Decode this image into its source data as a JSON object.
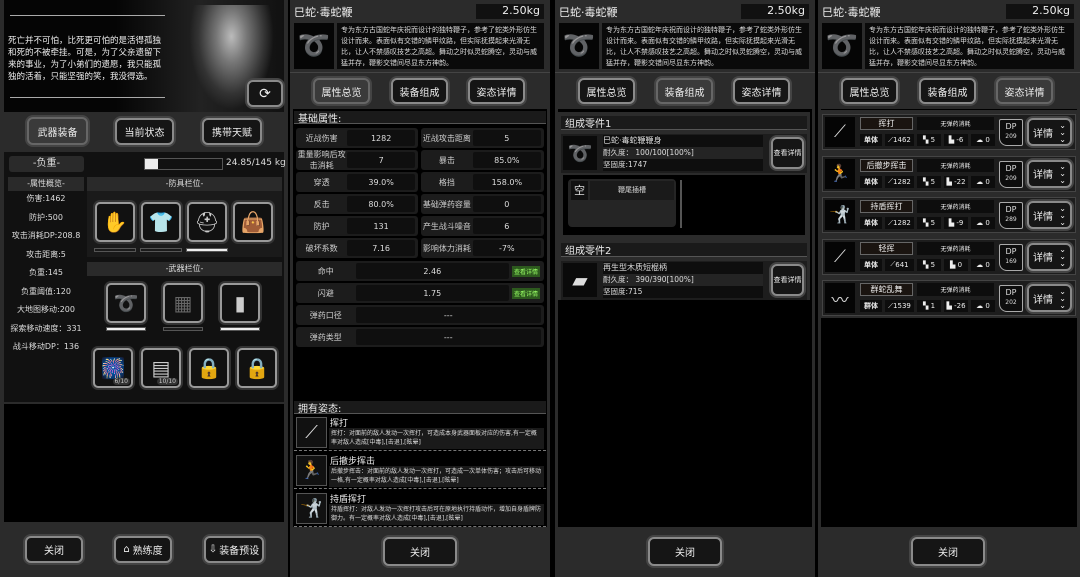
{
  "panel1": {
    "quote": "死亡并不可怕，比死更可怕的是活得孤独和死的不被牵挂。可是，为了父亲遗留下来的事业，为了小弟们的遗愿，我只能孤独的活着，只能坚强的笑，我没得选。",
    "tabs": [
      "武器装备",
      "当前状态",
      "携带天赋"
    ],
    "load": {
      "label": "-负重-",
      "value": "24.85/145 kg",
      "fraction": 0.17
    },
    "attr_title": "-属性概览-",
    "attrs": [
      "伤害:1462",
      "防护:500",
      "攻击消耗DP:208.8",
      "攻击距离:5",
      "负重:145",
      "负重阈值:120",
      "大地图移动:200",
      "探索移动速度：331",
      "战斗移动DP：136"
    ],
    "armor_title": "-防具栏位-",
    "weapon_title": "-武器栏位-",
    "consumables": [
      "6/10",
      "10/10"
    ],
    "buttons": {
      "close": "关闭",
      "proficiency": "熟练度",
      "preset": "装备预设"
    }
  },
  "weapon": {
    "name": "巳蛇·毒蛇鞭",
    "weight": "2.50kg",
    "desc": "专为东方古国蛇年庆祝而设计的独特鞭子，参考了蛇类外形仿生设计而来。表面似有交错的鳞甲纹路，但实际抚摸起来光滑无比，让人不禁感叹技艺之高超。舞动之时似灵蛇腾空，灵动与威猛并存，鞭影交错间尽显东方神韵。",
    "tabs": [
      "属性总览",
      "装备组成",
      "姿态详情"
    ]
  },
  "stats": {
    "title": "基础属性:",
    "pairs": [
      [
        "近战伤害",
        "1282",
        "近战攻击距离",
        "5"
      ],
      [
        "重量影响后攻击消耗",
        "7",
        "暴击",
        "85.0%"
      ],
      [
        "穿透",
        "39.0%",
        "格挡",
        "158.0%"
      ],
      [
        "反击",
        "80.0%",
        "基础弹药容量",
        "0"
      ],
      [
        "防护",
        "131",
        "产生战斗噪音",
        "6"
      ],
      [
        "破坏系数",
        "7.16",
        "影响体力消耗",
        "-7%"
      ]
    ],
    "wide": [
      {
        "label": "命中",
        "value": "2.46",
        "detail": "查看详情"
      },
      {
        "label": "闪避",
        "value": "1.75",
        "detail": "查看详情"
      },
      {
        "label": "弹药口径",
        "value": "---"
      },
      {
        "label": "弹药类型",
        "value": "---"
      }
    ]
  },
  "stances": {
    "title": "拥有姿态:",
    "items": [
      {
        "name": "挥打",
        "desc": "挥打：对面前的敌人发动一次挥打，可造成本身武器面板对应的伤害,有一定概率对敌人造成[中毒],[击退],[眩晕]"
      },
      {
        "name": "后撤步挥击",
        "desc": "后撤步挥击：对面前的敌人发动一次挥打，可造成一次单体伤害；攻击后可移动一格,有一定概率对敌人造成[中毒],[击退],[眩晕]"
      },
      {
        "name": "持盾挥打",
        "desc": "持盾挥打：对敌人发动一次挥打攻击后可在原地执行持盾动作，增加自身盾牌防御力。有一定概率对敌人造成[中毒],[击退],[眩晕]"
      }
    ]
  },
  "parts": [
    {
      "title": "组成零件1",
      "name": "巳蛇·毒蛇鞭鞭身",
      "durability": "耐久度： 100/100[100%]",
      "hardness": "坚固度:1747",
      "detail": "查看详情"
    },
    {
      "title": "组成零件2",
      "name": "再生型木质短棍柄",
      "durability": "耐久度： 390/390[100%]",
      "hardness": "坚固度:715",
      "detail": "查看详情"
    }
  ],
  "slot": {
    "empty": "空",
    "name": "鞭尾插槽"
  },
  "moves": [
    {
      "name": "挥打",
      "cost": "无弹药消耗",
      "target": "单体",
      "damage": "1462",
      "range": "5",
      "move": "-6",
      "noise": "0",
      "dp_label": "DP",
      "dp": "209",
      "detail": "详情"
    },
    {
      "name": "后撤步挥击",
      "cost": "无弹药消耗",
      "target": "单体",
      "damage": "1282",
      "range": "5",
      "move": "-22",
      "noise": "0",
      "dp_label": "DP",
      "dp": "209",
      "detail": "详情"
    },
    {
      "name": "持盾挥打",
      "cost": "无弹药消耗",
      "target": "单体",
      "damage": "1282",
      "range": "5",
      "move": "-9",
      "noise": "0",
      "dp_label": "DP",
      "dp": "289",
      "detail": "详情"
    },
    {
      "name": "轻挥",
      "cost": "无弹药消耗",
      "target": "单体",
      "damage": "641",
      "range": "5",
      "move": "0",
      "noise": "0",
      "dp_label": "DP",
      "dp": "169",
      "detail": "详情"
    },
    {
      "name": "群蛇乱舞",
      "cost": "无弹药消耗",
      "target": "群体",
      "damage": "1539",
      "range": "1",
      "move": "-26",
      "noise": "0",
      "dp_label": "DP",
      "dp": "202",
      "detail": "详情"
    }
  ],
  "close": "关闭"
}
